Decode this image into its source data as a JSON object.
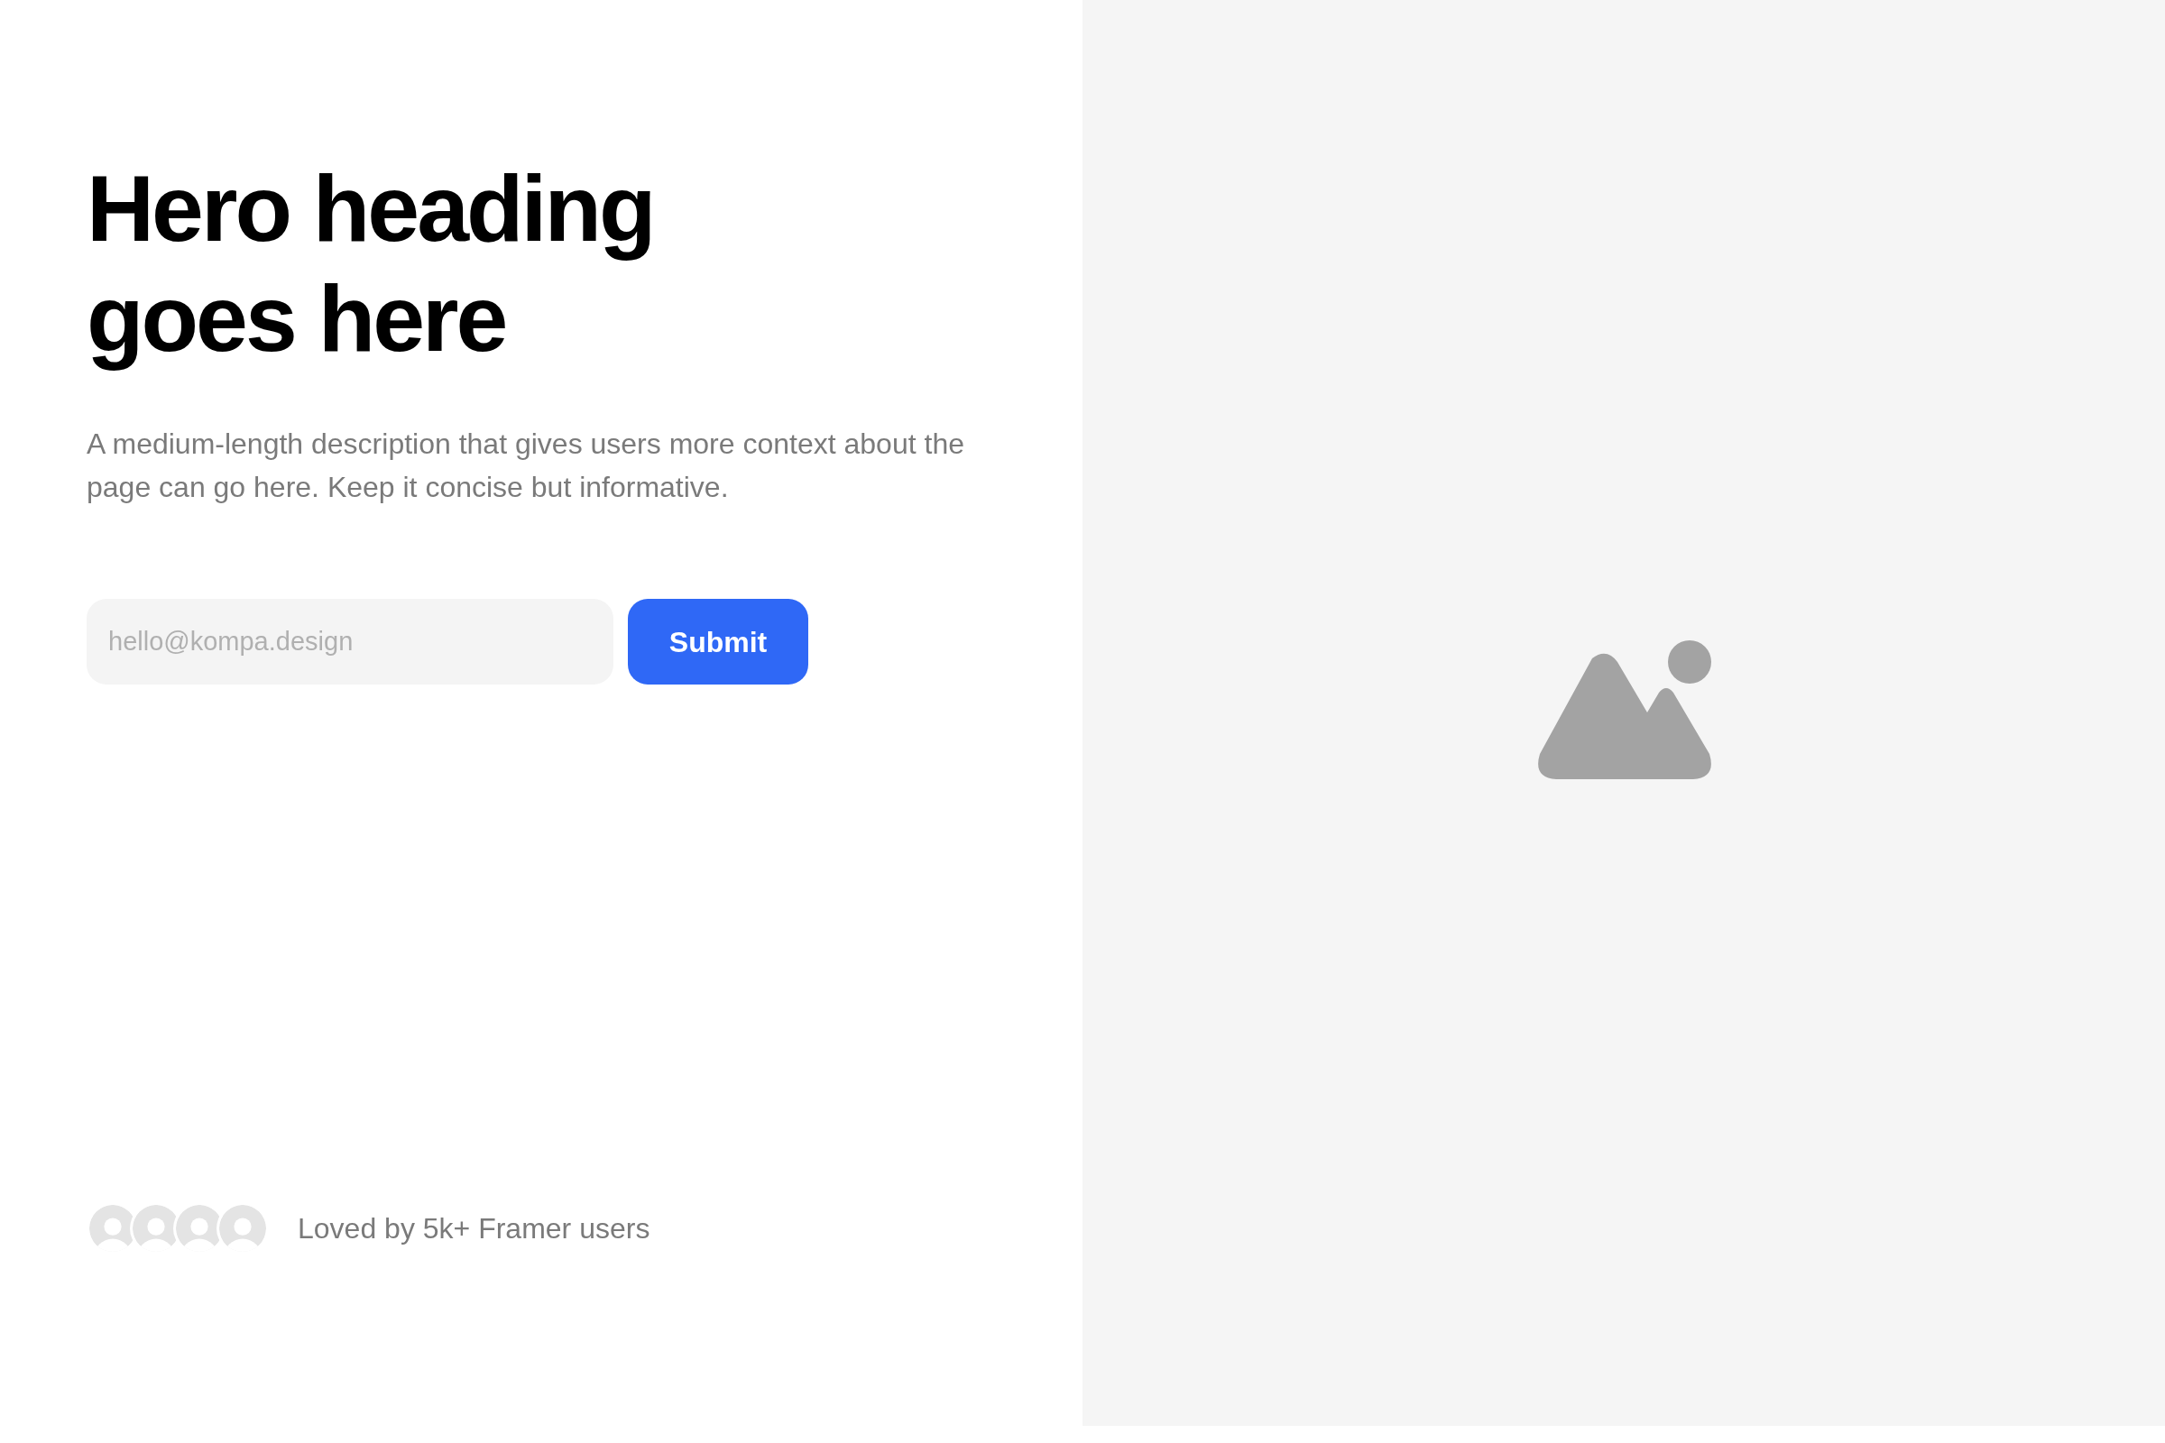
{
  "hero": {
    "heading": "Hero heading goes here",
    "description": "A medium-length description that gives users more context about the page can go here. Keep it concise but informative.",
    "email_field": {
      "placeholder": "hello@kompa.design"
    },
    "submit_button": "Submit"
  },
  "social_proof": {
    "avatars": [
      {
        "kind": "placeholder"
      },
      {
        "kind": "placeholder"
      },
      {
        "kind": "placeholder"
      },
      {
        "kind": "placeholder"
      }
    ],
    "text": "Loved by 5k+ Framer users"
  },
  "media": {
    "kind": "image-placeholder"
  }
}
